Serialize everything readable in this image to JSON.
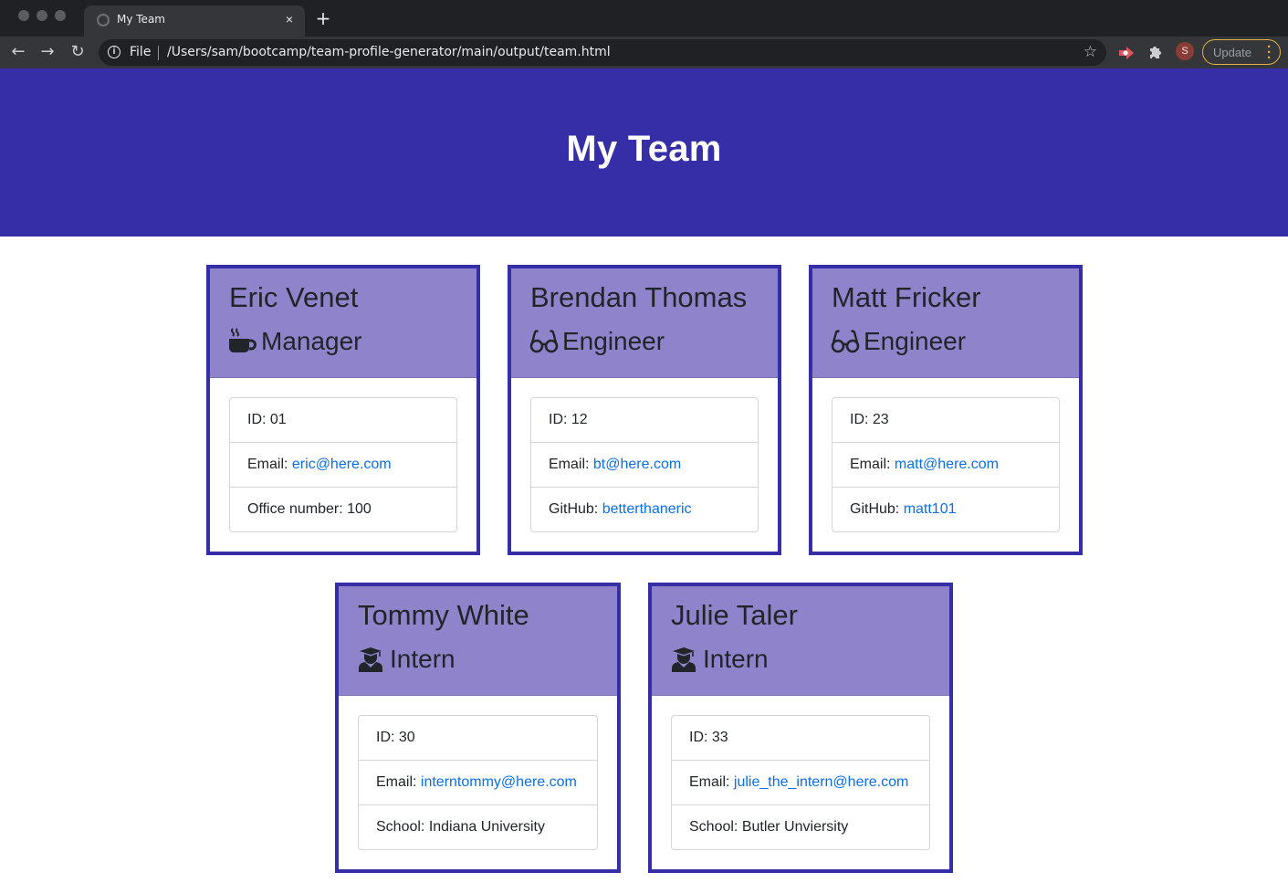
{
  "browser": {
    "tab_title": "My Team",
    "new_tab": "+",
    "tab_close": "×",
    "file_label": "File",
    "url": "/Users/sam/bootcamp/team-profile-generator/main/output/team.html",
    "profile_initial": "S",
    "update_label": "Update",
    "nav": {
      "back": "←",
      "forward": "→",
      "reload": "↻"
    },
    "icons": [
      "back-arrow-icon",
      "forward-arrow-icon",
      "reload-icon",
      "info-icon",
      "star-icon",
      "extension-icon",
      "puzzle-icon",
      "kebab-menu-icon"
    ]
  },
  "page": {
    "heading": "My Team",
    "colors": {
      "primary": "#352ea7",
      "card_header": "#8f84cb",
      "link": "#0b6fe6"
    }
  },
  "team": [
    {
      "name": "Eric Venet",
      "role": "Manager",
      "icon": "coffee-mug-icon",
      "id_label": "ID: ",
      "id": "01",
      "email_label": "Email: ",
      "email": "eric@here.com",
      "extra_label": "Office number: ",
      "extra": "100"
    },
    {
      "name": "Brendan Thomas",
      "role": "Engineer",
      "icon": "glasses-icon",
      "id_label": "ID: ",
      "id": "12",
      "email_label": "Email: ",
      "email": "bt@here.com",
      "extra_label": "GitHub: ",
      "extra": "betterthaneric"
    },
    {
      "name": "Matt Fricker",
      "role": "Engineer",
      "icon": "glasses-icon",
      "id_label": "ID: ",
      "id": "23",
      "email_label": "Email: ",
      "email": "matt@here.com",
      "extra_label": "GitHub: ",
      "extra": "matt101"
    },
    {
      "name": "Tommy White",
      "role": "Intern",
      "icon": "graduate-icon",
      "id_label": "ID: ",
      "id": "30",
      "email_label": "Email: ",
      "email": "interntommy@here.com",
      "extra_label": "School: ",
      "extra": "Indiana University"
    },
    {
      "name": "Julie Taler",
      "role": "Intern",
      "icon": "graduate-icon",
      "id_label": "ID: ",
      "id": "33",
      "email_label": "Email: ",
      "email": "julie_the_intern@here.com",
      "extra_label": "School: ",
      "extra": "Butler Unviersity"
    }
  ]
}
